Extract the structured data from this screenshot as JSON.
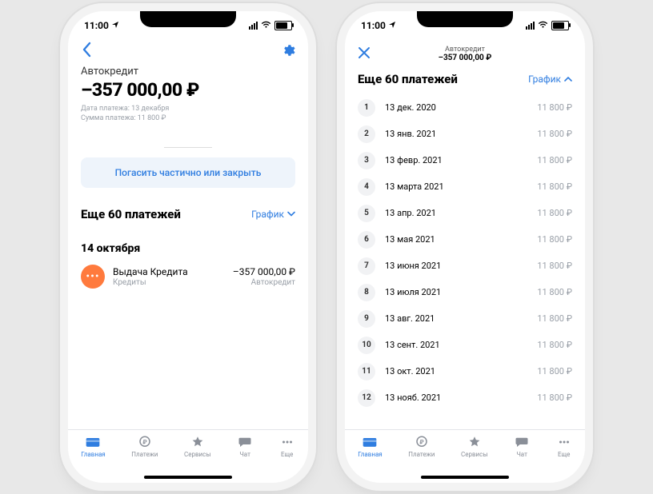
{
  "status": {
    "time": "11:00"
  },
  "phoneA": {
    "account_title": "Автокредит",
    "balance": "–357 000,00 ₽",
    "meta_line1": "Дата платежа: 13 декабря",
    "meta_line2": "Сумма платежа: 11 800 ₽",
    "primary_button": "Погасить частично или закрыть",
    "section_title": "Еще 60 платежей",
    "section_link": "График",
    "date_heading": "14 октября",
    "txn": {
      "title": "Выдача Кредита",
      "subtitle": "Кредиты",
      "amount": "–357 000,00 ₽",
      "amount_sub": "Автокредит"
    }
  },
  "phoneB": {
    "header_small": "Автокредит",
    "header_amount": "–357 000,00 ₽",
    "title": "Еще 60 платежей",
    "link": "График",
    "rows": [
      {
        "n": "1",
        "date": "13 дек. 2020",
        "amt": "11 800 ₽"
      },
      {
        "n": "2",
        "date": "13 янв. 2021",
        "amt": "11 800 ₽"
      },
      {
        "n": "3",
        "date": "13 февр. 2021",
        "amt": "11 800 ₽"
      },
      {
        "n": "4",
        "date": "13 марта 2021",
        "amt": "11 800 ₽"
      },
      {
        "n": "5",
        "date": "13 апр. 2021",
        "amt": "11 800 ₽"
      },
      {
        "n": "6",
        "date": "13 мая 2021",
        "amt": "11 800 ₽"
      },
      {
        "n": "7",
        "date": "13 июня 2021",
        "amt": "11 800 ₽"
      },
      {
        "n": "8",
        "date": "13 июля 2021",
        "amt": "11 800 ₽"
      },
      {
        "n": "9",
        "date": "13 авг. 2021",
        "amt": "11 800 ₽"
      },
      {
        "n": "10",
        "date": "13 сент. 2021",
        "amt": "11 800 ₽"
      },
      {
        "n": "11",
        "date": "13 окт. 2021",
        "amt": "11 800 ₽"
      },
      {
        "n": "12",
        "date": "13 нояб. 2021",
        "amt": "11 800 ₽"
      }
    ]
  },
  "tabs": {
    "home": "Главная",
    "payments": "Платежи",
    "services": "Сервисы",
    "chat": "Чат",
    "more": "Еще"
  }
}
